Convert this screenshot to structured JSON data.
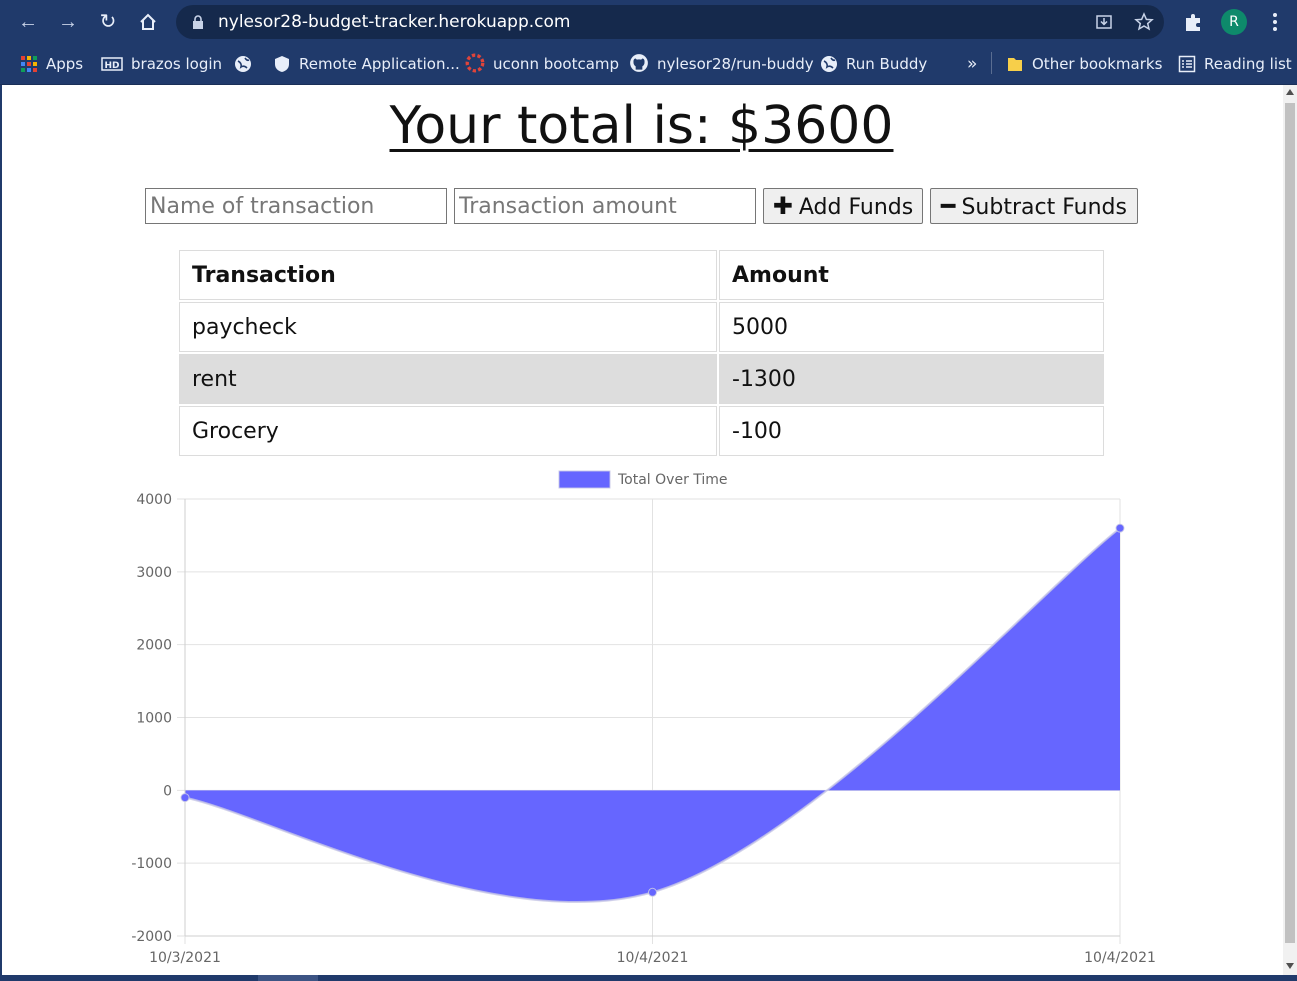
{
  "browser": {
    "url": "nylesor28-budget-tracker.herokuapp.com",
    "profile_initial": "R",
    "bookmarks": [
      {
        "label": "Apps",
        "icon": "apps-grid-icon"
      },
      {
        "label": "brazos login",
        "icon": "hd-icon"
      },
      {
        "label": "",
        "icon": "globe-icon"
      },
      {
        "label": "Remote Application...",
        "icon": "shield-icon"
      },
      {
        "label": "uconn bootcamp",
        "icon": "uconn-icon"
      },
      {
        "label": "nylesor28/run-buddy",
        "icon": "github-icon"
      },
      {
        "label": "Run Buddy",
        "icon": "globe-icon"
      }
    ],
    "overflow_label": "»",
    "other_bookmarks": "Other bookmarks",
    "reading_list": "Reading list"
  },
  "page": {
    "total_title": "Your total is: $3600",
    "name_placeholder": "Name of transaction",
    "amount_placeholder": "Transaction amount",
    "add_symbol": "✚",
    "add_label": "Add Funds",
    "subtract_symbol": "━",
    "subtract_label": "Subtract Funds",
    "table": {
      "headers": [
        "Transaction",
        "Amount"
      ],
      "rows": [
        {
          "name": "paycheck",
          "amount": "5000"
        },
        {
          "name": "rent",
          "amount": "-1300"
        },
        {
          "name": "Grocery",
          "amount": "-100"
        }
      ]
    }
  },
  "chart_data": {
    "type": "area",
    "title": "",
    "x": [
      "10/3/2021",
      "10/4/2021",
      "10/4/2021"
    ],
    "series": [
      {
        "name": "Total Over Time",
        "values": [
          -100,
          -1400,
          3600
        ],
        "color": "#6666ff"
      }
    ],
    "ylim": [
      -2000,
      4000
    ],
    "yticks": [
      "4000",
      "3000",
      "2000",
      "1000",
      "0",
      "-1000",
      "-2000"
    ],
    "grid": true,
    "legend": "top"
  }
}
